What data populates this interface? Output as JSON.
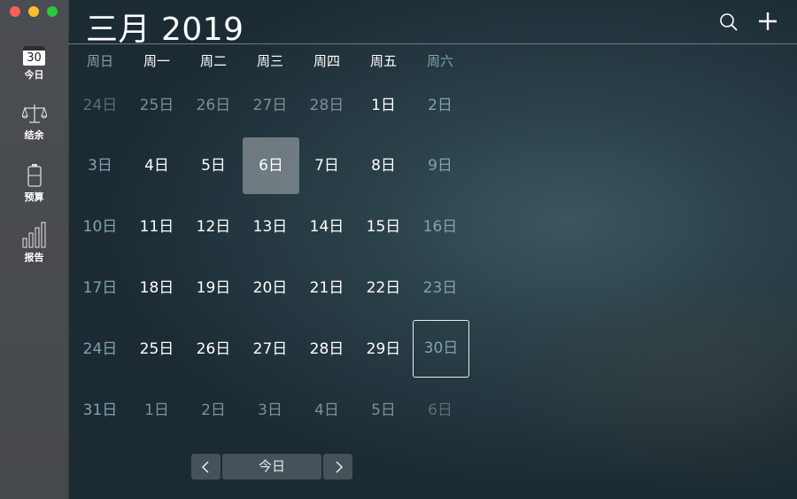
{
  "window": {
    "controls": [
      "close",
      "minimize",
      "maximize"
    ]
  },
  "sidebar": {
    "items": [
      {
        "label": "今日",
        "icon": "calendar-icon",
        "badge": "30"
      },
      {
        "label": "结余",
        "icon": "scales-icon"
      },
      {
        "label": "预算",
        "icon": "battery-icon"
      },
      {
        "label": "报告",
        "icon": "bar-chart-icon"
      }
    ]
  },
  "header": {
    "title": "三月 2019",
    "actions": [
      "search-icon",
      "add-icon"
    ]
  },
  "weekdays": [
    "周日",
    "周一",
    "周二",
    "周三",
    "周四",
    "周五",
    "周六"
  ],
  "weeks": [
    [
      "24日",
      "25日",
      "26日",
      "27日",
      "28日",
      "1日",
      "2日"
    ],
    [
      "3日",
      "4日",
      "5日",
      "6日",
      "7日",
      "8日",
      "9日"
    ],
    [
      "10日",
      "11日",
      "12日",
      "13日",
      "14日",
      "15日",
      "16日"
    ],
    [
      "17日",
      "18日",
      "19日",
      "20日",
      "21日",
      "22日",
      "23日"
    ],
    [
      "24日",
      "25日",
      "26日",
      "27日",
      "28日",
      "29日",
      "30日"
    ],
    [
      "31日",
      "1日",
      "2日",
      "3日",
      "4日",
      "5日",
      "6日"
    ]
  ],
  "selected_date": "6日",
  "today_date": "30日",
  "footer": {
    "today_label": "今日",
    "prev_icon": "chevron-left-icon",
    "next_icon": "chevron-right-icon"
  },
  "colors": {
    "weekend": "#7fa4aa",
    "current_month": "#ffffff",
    "other_month": "#7e8f96"
  }
}
